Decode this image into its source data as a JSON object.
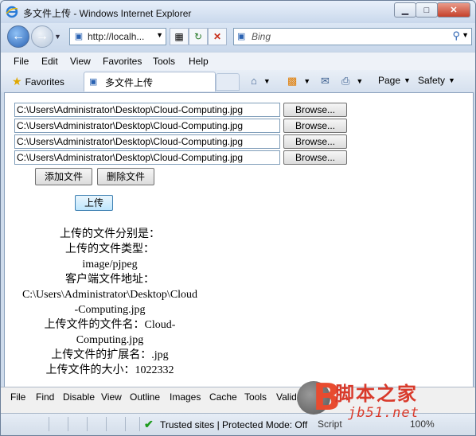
{
  "window": {
    "title": "多文件上传 - Windows Internet Explorer",
    "minimize_glyph": "▁",
    "maximize_glyph": "□",
    "close_glyph": "✕"
  },
  "nav": {
    "address": "http://localh...",
    "search_placeholder": "Bing"
  },
  "menu": [
    "File",
    "Edit",
    "View",
    "Favorites",
    "Tools",
    "Help"
  ],
  "favorites_label": "Favorites",
  "tab_title": "多文件上传",
  "toolbar": {
    "page": "Page",
    "safety": "Safety"
  },
  "form": {
    "files": [
      "C:\\Users\\Administrator\\Desktop\\Cloud-Computing.jpg",
      "C:\\Users\\Administrator\\Desktop\\Cloud-Computing.jpg",
      "C:\\Users\\Administrator\\Desktop\\Cloud-Computing.jpg",
      "C:\\Users\\Administrator\\Desktop\\Cloud-Computing.jpg"
    ],
    "browse_label": "Browse...",
    "add_label": "添加文件",
    "delete_label": "删除文件",
    "upload_label": "上传"
  },
  "result_lines": [
    "上传的文件分别是：",
    "上传的文件类型：",
    "image/pjpeg",
    "客户端文件地址：",
    "C:\\Users\\Administrator\\Desktop\\Cloud",
    "-Computing.jpg",
    "上传文件的文件名：Cloud-",
    "Computing.jpg",
    "上传文件的扩展名：.jpg",
    "上传文件的大小：1022332"
  ],
  "devbar": [
    "File",
    "Find",
    "Disable",
    "View",
    "Outline",
    "Images",
    "Cache",
    "Tools",
    "Validate"
  ],
  "status": {
    "zone": "Trusted sites | Protected Mode: Off",
    "script": "Script",
    "zoom": "100%"
  },
  "watermark": {
    "brand_cn": "脚本之家",
    "brand_url": "jb51.net"
  }
}
